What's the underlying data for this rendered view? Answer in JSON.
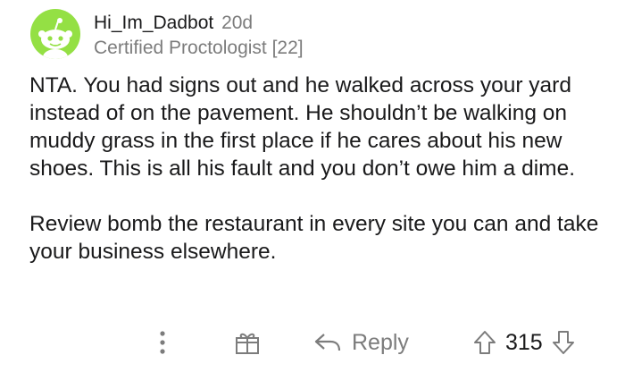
{
  "comment": {
    "author": "Hi_Im_Dadbot",
    "age": "20d",
    "flair": "Certified Proctologist [22]",
    "paragraphs": [
      "NTA. You had signs out and he walked across your yard instead of on the pavement. He shouldn’t be walking on muddy grass in the first place if he cares about his new shoes. This is all his fault and you don’t owe him a dime.",
      "Review bomb the restaurant in every site you can and take your business elsewhere."
    ]
  },
  "actions": {
    "more_icon": "vertical-dots-icon",
    "award_icon": "gift-icon",
    "reply_icon": "reply-arrow-icon",
    "reply_label": "Reply",
    "upvote_icon": "upvote-arrow-icon",
    "score": "315",
    "downvote_icon": "downvote-arrow-icon"
  },
  "colors": {
    "avatar_bg": "#94e044",
    "text": "#1a1a1b",
    "muted": "#7c7c7c"
  }
}
